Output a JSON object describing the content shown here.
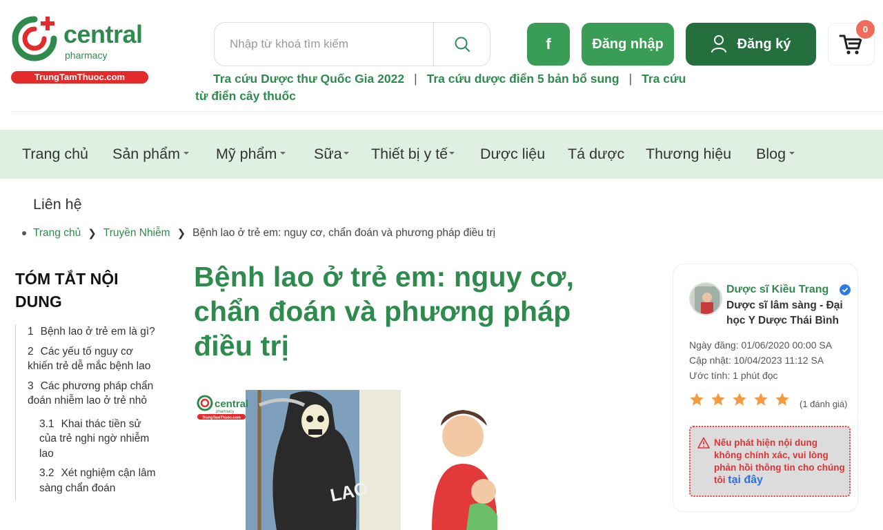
{
  "brand": {
    "name": "central",
    "sub": "pharmacy",
    "site": "TrungTamThuoc.com"
  },
  "search": {
    "placeholder": "Nhập từ khoá tìm kiếm"
  },
  "header": {
    "facebook_label": "f",
    "login_label": "Đăng nhập",
    "register_label": "Đăng ký",
    "cart_count": "0"
  },
  "quicklinks": [
    "Tra cứu Dược thư Quốc Gia 2022",
    "Tra cứu dược điển 5 bản bổ sung",
    "Tra cứu",
    "từ điển cây thuốc"
  ],
  "nav": {
    "items": [
      "Trang chủ",
      "Sản phẩm",
      "Mỹ phẩm",
      "Sữa",
      "Thiết bị y tế",
      "Dược liệu",
      "Tá dược",
      "Thương hiệu",
      "Blog"
    ],
    "contact": "Liên hệ"
  },
  "breadcrumb": {
    "home": "Trang chủ",
    "category": "Truyền Nhiễm",
    "current": "Bệnh lao ở trẻ em: nguy cơ, chẩn đoán và phương pháp điều trị"
  },
  "toc": {
    "title": "TÓM TẮT NỘI DUNG",
    "items": [
      {
        "num": "1",
        "text": "Bệnh lao ở trẻ em là gì?"
      },
      {
        "num": "2",
        "text": "Các yếu tố nguy cơ khiến trẻ dễ mắc bệnh lao"
      },
      {
        "num": "3",
        "text": "Các phương pháp chẩn đoán nhiễm lao ở trẻ nhỏ"
      },
      {
        "num": "3.1",
        "text": "Khai thác tiền sử của trẻ nghi ngờ nhiễm lao"
      },
      {
        "num": "3.2",
        "text": "Xét nghiệm cận lâm sàng chẩn đoán"
      }
    ]
  },
  "article": {
    "title": "Bệnh lao ở trẻ em: nguy cơ, chẩn đoán và phương pháp điều trị",
    "image_brand": "central",
    "image_sub": "pharmacy",
    "image_site": "TrungTamThuoc.com",
    "image_word": "LAO"
  },
  "author": {
    "name": "Dược sĩ Kiều Trang",
    "role": "Dược sĩ lâm sàng - Đại học Y Dược Thái Bình",
    "posted": "Ngày đăng: 01/06/2020 00:00 SA",
    "updated": "Cập nhật: 10/04/2023 11:12 SA",
    "read_time": "Ước tính: 1 phút đọc",
    "rating_stars": 5,
    "rating_count": "(1 đánh giá)",
    "report_text": "Nếu phát hiện nội dung không chính xác, vui lòng phản hồi thông tin cho chúng tôi",
    "report_link": "tại đây"
  },
  "colors": {
    "brand_green": "#2e8b4d",
    "nav_bg": "#dff0e2",
    "dark_green": "#256f3e",
    "red": "#e32b2b",
    "star": "#f59a42"
  }
}
